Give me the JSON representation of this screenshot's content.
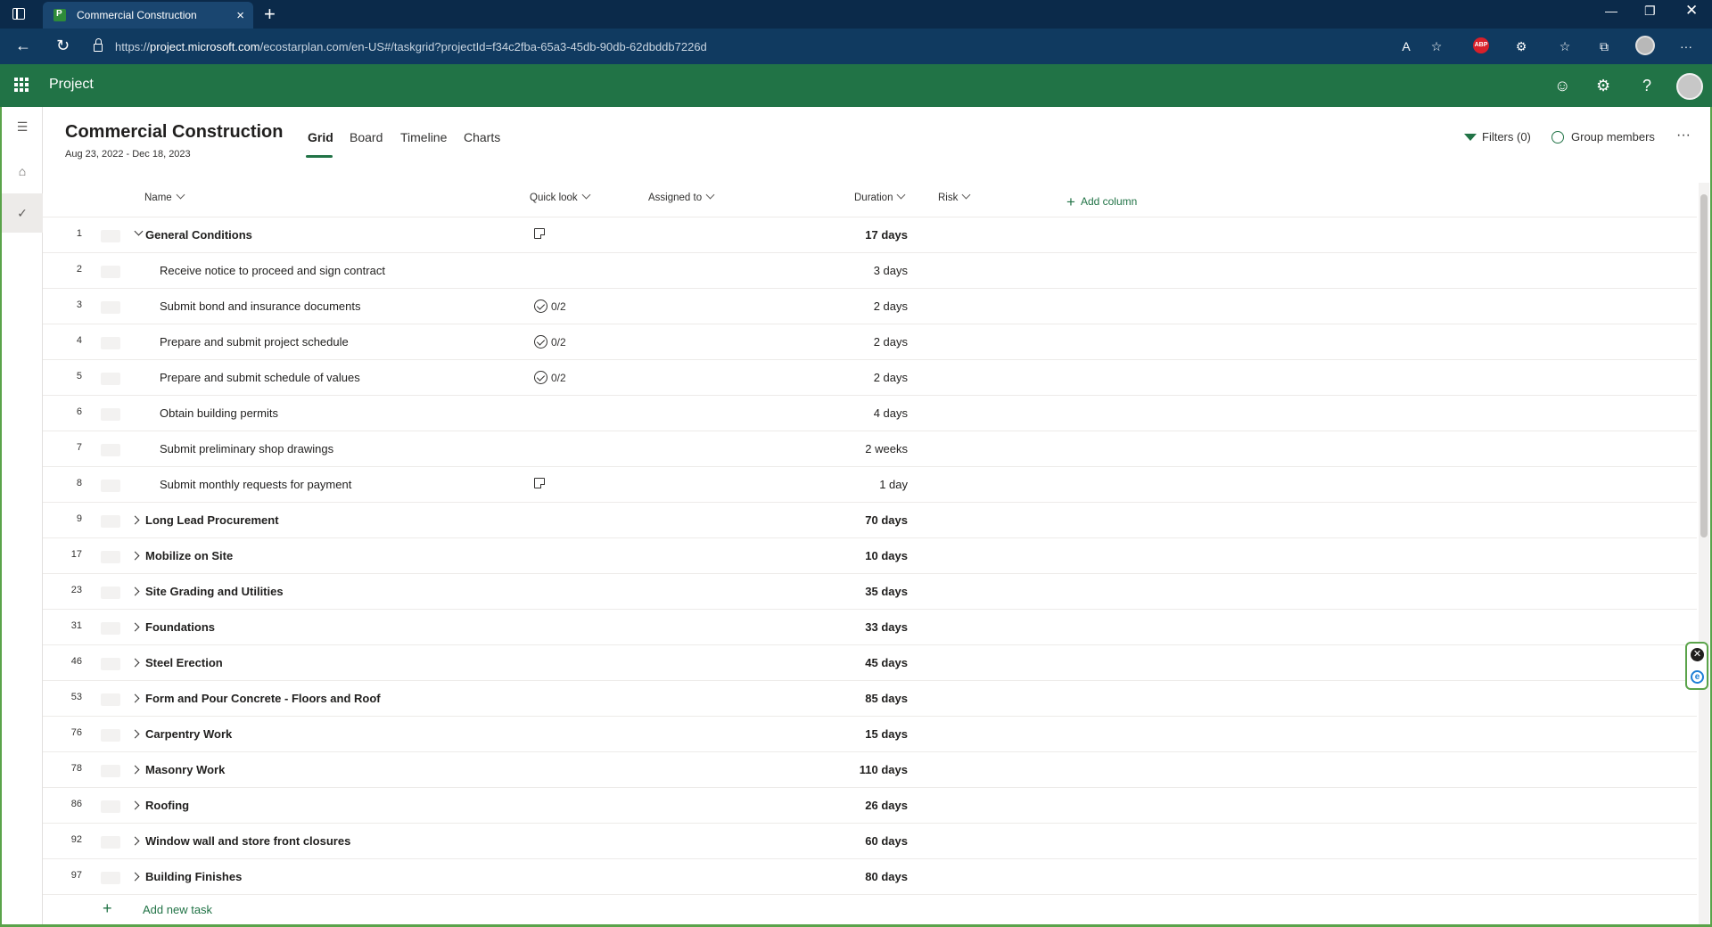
{
  "browser": {
    "tab_title": "Commercial Construction",
    "url_prefix": "https://",
    "url_host": "project.microsoft.com",
    "url_path": "/ecostarplan.com/en-US#/taskgrid?projectId=f34c2fba-65a3-45db-90db-62dbddb7226d",
    "extension_badge": "ABP"
  },
  "app": {
    "name": "Project",
    "brand_color": "#217346"
  },
  "project": {
    "title": "Commercial Construction",
    "dates": "Aug 23, 2022 - Dec 18, 2023"
  },
  "views": [
    {
      "label": "Grid",
      "active": true
    },
    {
      "label": "Board",
      "active": false
    },
    {
      "label": "Timeline",
      "active": false
    },
    {
      "label": "Charts",
      "active": false
    }
  ],
  "toolbar": {
    "filters_label": "Filters (0)",
    "group_label": "Group members"
  },
  "columns": {
    "name": "Name",
    "quick_look": "Quick look",
    "assigned_to": "Assigned to",
    "duration": "Duration",
    "risk": "Risk",
    "add_column": "Add column"
  },
  "tasks": [
    {
      "num": "1",
      "name": "General Conditions",
      "summary": true,
      "expanded": true,
      "quick_look": "note",
      "ql_text": "",
      "duration": "17 days"
    },
    {
      "num": "2",
      "name": "Receive notice to proceed and sign contract",
      "summary": false,
      "quick_look": "",
      "ql_text": "",
      "duration": "3 days"
    },
    {
      "num": "3",
      "name": "Submit bond and insurance documents",
      "summary": false,
      "quick_look": "checklist",
      "ql_text": "0/2",
      "duration": "2 days"
    },
    {
      "num": "4",
      "name": "Prepare and submit project schedule",
      "summary": false,
      "quick_look": "checklist",
      "ql_text": "0/2",
      "duration": "2 days"
    },
    {
      "num": "5",
      "name": "Prepare and submit schedule of values",
      "summary": false,
      "quick_look": "checklist",
      "ql_text": "0/2",
      "duration": "2 days"
    },
    {
      "num": "6",
      "name": "Obtain building permits",
      "summary": false,
      "quick_look": "",
      "ql_text": "",
      "duration": "4 days"
    },
    {
      "num": "7",
      "name": "Submit preliminary shop drawings",
      "summary": false,
      "quick_look": "",
      "ql_text": "",
      "duration": "2 weeks"
    },
    {
      "num": "8",
      "name": "Submit monthly requests for payment",
      "summary": false,
      "quick_look": "note",
      "ql_text": "",
      "duration": "1 day"
    },
    {
      "num": "9",
      "name": "Long Lead Procurement",
      "summary": true,
      "expanded": false,
      "quick_look": "",
      "ql_text": "",
      "duration": "70 days"
    },
    {
      "num": "17",
      "name": "Mobilize on Site",
      "summary": true,
      "expanded": false,
      "quick_look": "",
      "ql_text": "",
      "duration": "10 days"
    },
    {
      "num": "23",
      "name": "Site Grading and Utilities",
      "summary": true,
      "expanded": false,
      "quick_look": "",
      "ql_text": "",
      "duration": "35 days"
    },
    {
      "num": "31",
      "name": "Foundations",
      "summary": true,
      "expanded": false,
      "quick_look": "",
      "ql_text": "",
      "duration": "33 days"
    },
    {
      "num": "46",
      "name": "Steel Erection",
      "summary": true,
      "expanded": false,
      "quick_look": "",
      "ql_text": "",
      "duration": "45 days"
    },
    {
      "num": "53",
      "name": "Form and Pour Concrete - Floors and Roof",
      "summary": true,
      "expanded": false,
      "quick_look": "",
      "ql_text": "",
      "duration": "85 days"
    },
    {
      "num": "76",
      "name": "Carpentry Work",
      "summary": true,
      "expanded": false,
      "quick_look": "",
      "ql_text": "",
      "duration": "15 days"
    },
    {
      "num": "78",
      "name": "Masonry Work",
      "summary": true,
      "expanded": false,
      "quick_look": "",
      "ql_text": "",
      "duration": "110 days"
    },
    {
      "num": "86",
      "name": "Roofing",
      "summary": true,
      "expanded": false,
      "quick_look": "",
      "ql_text": "",
      "duration": "26 days"
    },
    {
      "num": "92",
      "name": "Window wall and store front closures",
      "summary": true,
      "expanded": false,
      "quick_look": "",
      "ql_text": "",
      "duration": "60 days"
    },
    {
      "num": "97",
      "name": "Building Finishes",
      "summary": true,
      "expanded": false,
      "quick_look": "",
      "ql_text": "",
      "duration": "80 days"
    }
  ],
  "add_task_label": "Add new task"
}
